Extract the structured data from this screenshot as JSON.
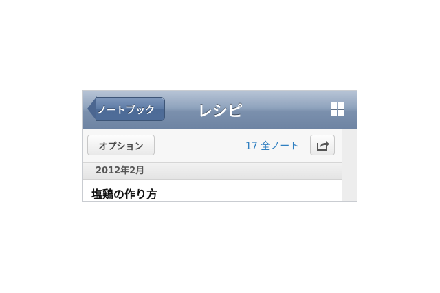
{
  "navbar": {
    "back_label": "ノートブック",
    "title": "レシピ",
    "view_icon": "grid-icon"
  },
  "toolbar": {
    "option_label": "オプション",
    "note_count": "17 全ノート",
    "share_icon": "share-icon"
  },
  "list": {
    "section_header": "2012年2月",
    "notes": [
      {
        "title": "塩鶏の作り方"
      }
    ]
  },
  "colors": {
    "navbar": "#7b90ad",
    "link": "#2f7fc1"
  }
}
